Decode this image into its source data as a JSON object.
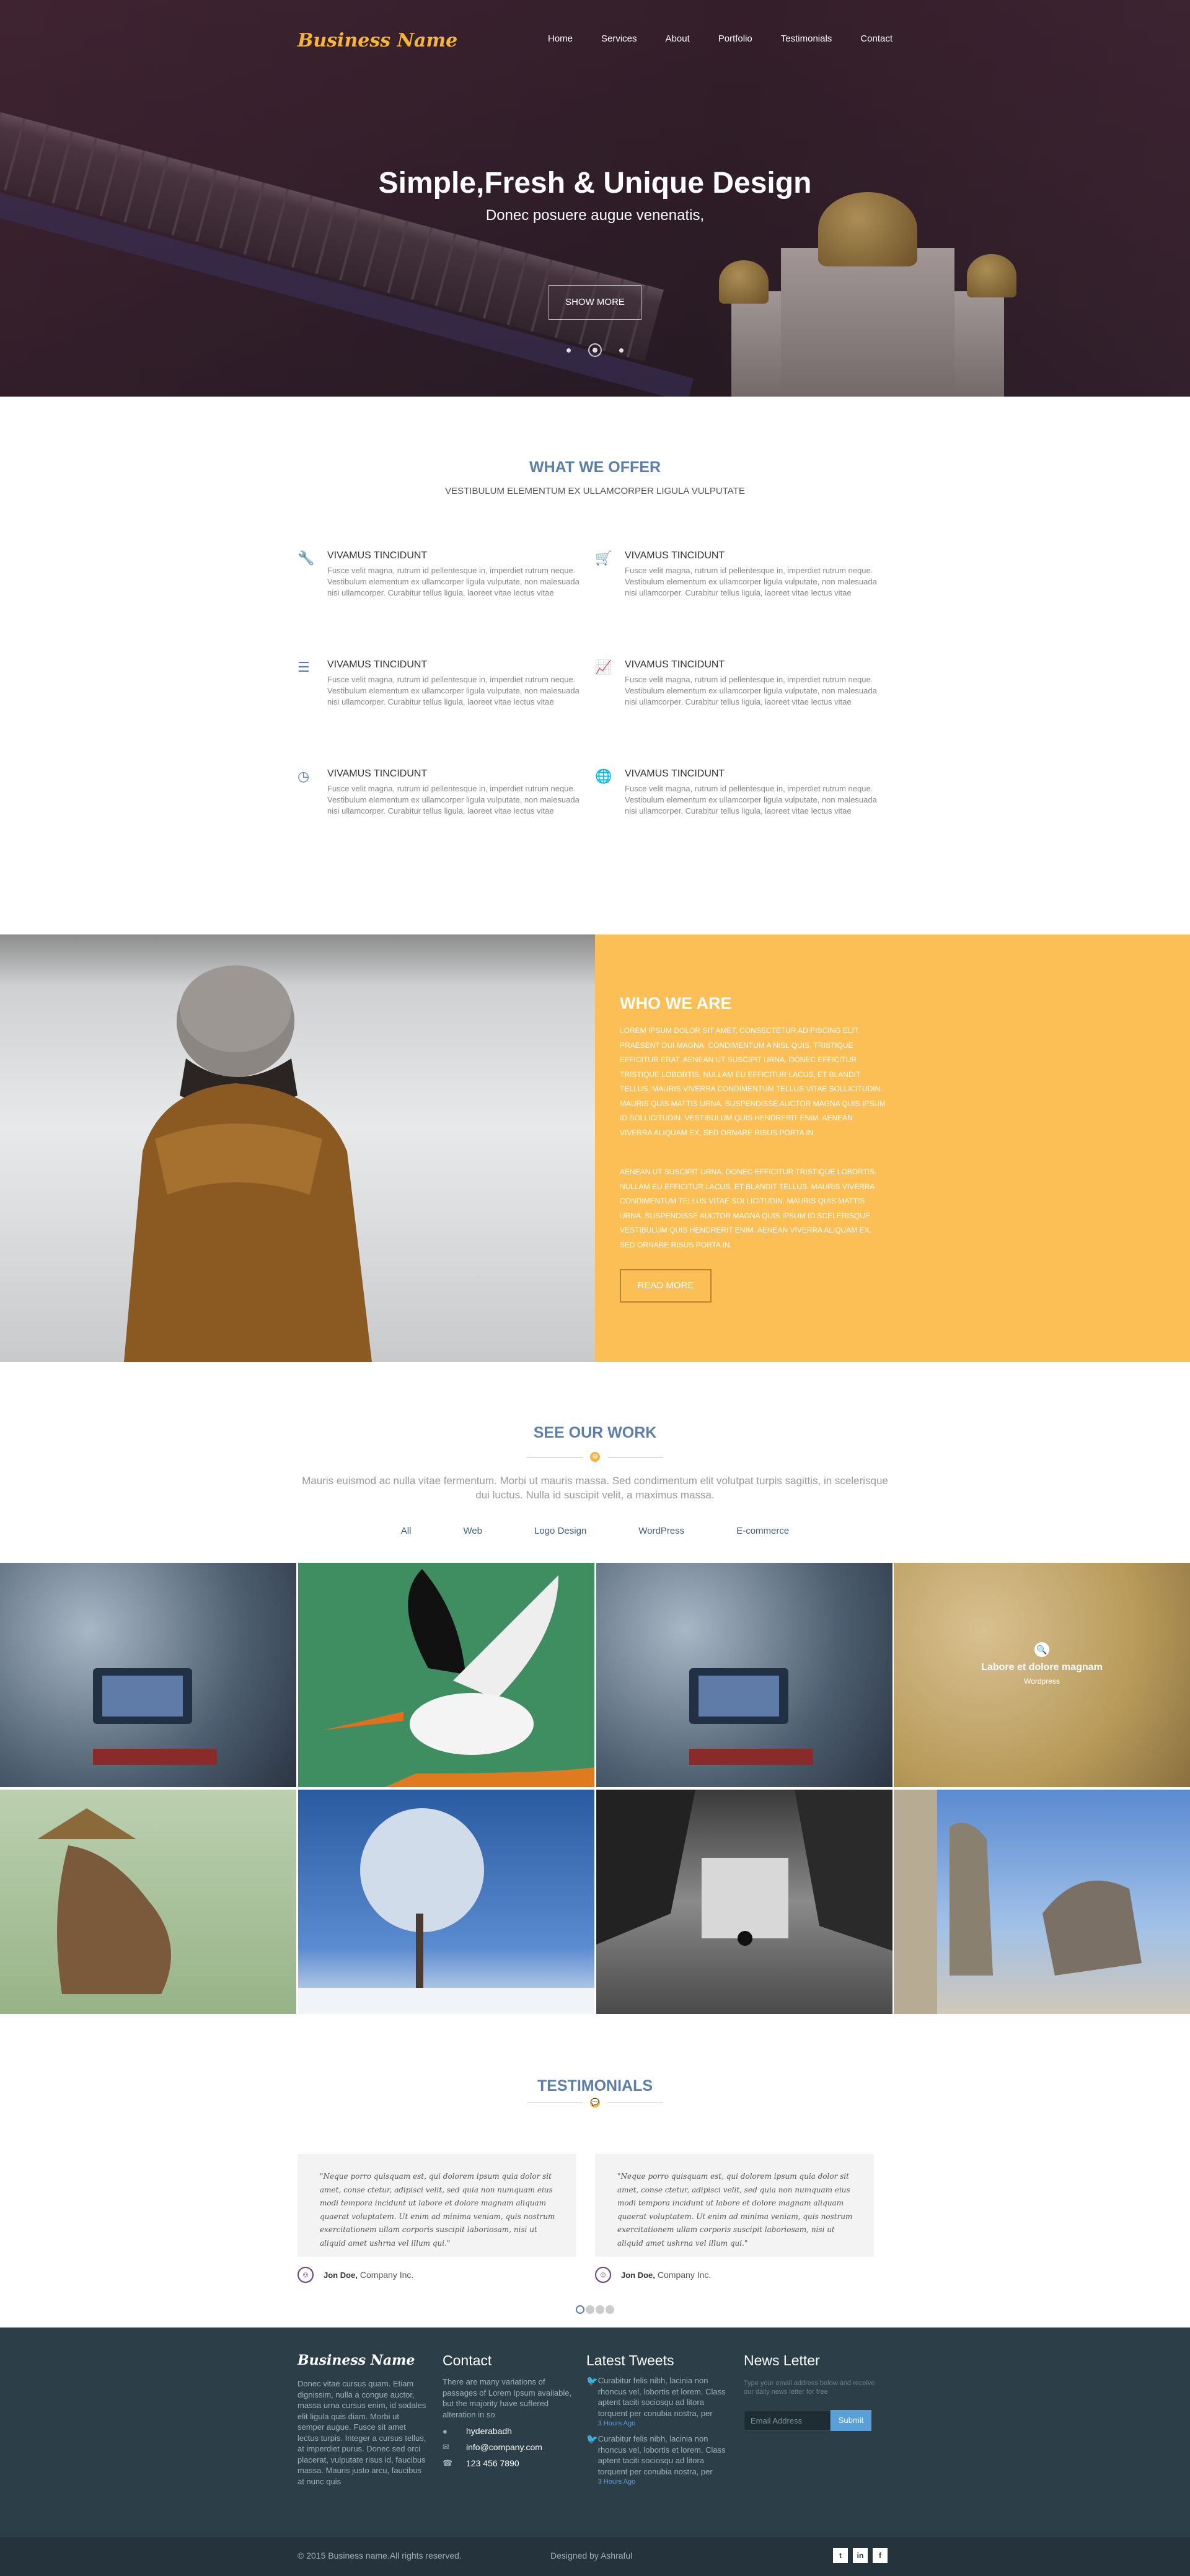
{
  "header": {
    "logo": "Business Name",
    "nav": [
      "Home",
      "Services",
      "About",
      "Portfolio",
      "Testimonials",
      "Contact"
    ]
  },
  "hero": {
    "title": "Simple,Fresh & Unique Design",
    "subtitle": "Donec posuere augue venenatis,",
    "button": "SHOW MORE"
  },
  "offer": {
    "title": "WHAT WE OFFER",
    "subtitle": "VESTIBULUM ELEMENTUM EX ULLAMCORPER LIGULA VULPUTATE",
    "features": [
      {
        "icon": "wrench-icon",
        "title": "VIVAMUS TINCIDUNT",
        "text": "Fusce velit magna, rutrum id pellentesque in, imperdiet rutrum neque. Vestibulum elementum ex ullamcorper ligula vulputate, non malesuada nisi ullamcorper. Curabitur tellus ligula, laoreet vitae lectus vitae"
      },
      {
        "icon": "basket-icon",
        "title": "VIVAMUS TINCIDUNT",
        "text": "Fusce velit magna, rutrum id pellentesque in, imperdiet rutrum neque. Vestibulum elementum ex ullamcorper ligula vulputate, non malesuada nisi ullamcorper. Curabitur tellus ligula, laoreet vitae lectus vitae"
      },
      {
        "icon": "database-icon",
        "title": "VIVAMUS TINCIDUNT",
        "text": "Fusce velit magna, rutrum id pellentesque in, imperdiet rutrum neque. Vestibulum elementum ex ullamcorper ligula vulputate, non malesuada nisi ullamcorper. Curabitur tellus ligula, laoreet vitae lectus vitae"
      },
      {
        "icon": "chart-icon",
        "title": "VIVAMUS TINCIDUNT",
        "text": "Fusce velit magna, rutrum id pellentesque in, imperdiet rutrum neque. Vestibulum elementum ex ullamcorper ligula vulputate, non malesuada nisi ullamcorper. Curabitur tellus ligula, laoreet vitae lectus vitae"
      },
      {
        "icon": "clock-icon",
        "title": "VIVAMUS TINCIDUNT",
        "text": "Fusce velit magna, rutrum id pellentesque in, imperdiet rutrum neque. Vestibulum elementum ex ullamcorper ligula vulputate, non malesuada nisi ullamcorper. Curabitur tellus ligula, laoreet vitae lectus vitae"
      },
      {
        "icon": "globe-icon",
        "title": "VIVAMUS TINCIDUNT",
        "text": "Fusce velit magna, rutrum id pellentesque in, imperdiet rutrum neque. Vestibulum elementum ex ullamcorper ligula vulputate, non malesuada nisi ullamcorper. Curabitur tellus ligula, laoreet vitae lectus vitae"
      }
    ]
  },
  "who": {
    "title": "WHO WE ARE",
    "p1": "Lorem ipsum dolor sit amet, consectetur adipiscing elit. Praesent dui magna, condimentum a nisl quis, tristique efficitur erat. Aenean ut suscipit urna. Donec efficitur tristique lobortis. Nullam eu efficitur lacus, et blandit tellus. Mauris viverra condimentum tellus vitae sollicitudin. Mauris quis mattis urna. Suspendisse auctor magna quis ipsum id sollicitudin. Vestibulum quis hendrerit enim. Aenean viverra aliquam ex, sed ornare risus porta in.",
    "p2": "Aenean ut suscipit urna. Donec efficitur tristique lobortis. Nullam eu efficitur lacus, et blandit tellus. Mauris viverra condimentum tellus vitae sollicitudin. Mauris quis mattis urna. Suspendisse auctor magna quis ipsum id scelerisque. Vestibulum quis hendrerit enim. Aenean viverra aliquam ex, sed ornare risus porta in.",
    "button": "READ MORE"
  },
  "work": {
    "title": "SEE OUR WORK",
    "subtitle": "Mauris euismod ac nulla vitae fermentum. Morbi ut mauris massa. Sed condimentum elit volutpat turpis sagittis, in scelerisque dui luctus. Nulla id suscipit velit, a maximus massa.",
    "filters": [
      "All",
      "Web",
      "Logo Design",
      "WordPress",
      "E-commerce"
    ],
    "hover_title": "Labore et dolore magnam",
    "hover_sub": "Wordpress"
  },
  "testimonials": {
    "title": "TESTIMONIALS",
    "quote": "\"Neque porro quisquam est, qui dolorem ipsum quia dolor sit amet, conse ctetur, adipisci velit, sed quia non numquam eius modi tempora incidunt ut labore et dolore magnam aliquam quaerat voluptatem. Ut enim ad minima veniam, quis nostrum exercitationem ullam corporis suscipit laboriosam, nisi ut aliquid amet ushrna vel illum qui.\"",
    "author": "Jon Doe,",
    "company": "Company Inc."
  },
  "footer": {
    "logo": "Business Name",
    "about": "Donec vitae cursus quam. Etiam dignissim, nulla a congue auctor, massa urna cursus enim, id sodales elit ligula quis diam. Morbi ut semper augue. Fusce sit amet lectus turpis. Integer a cursus tellus, at imperdiet purus. Donec sed orci placerat, vulputate risus id, faucibus massa. Mauris justo arcu, faucibus at nunc quis",
    "contact_title": "Contact",
    "contact_text": "There are many variations of passages of Lorem Ipsum available, but the majority have suffered alteration in so",
    "address": "hyderabadh",
    "email": "info@company.com",
    "phone": "123 456 7890",
    "tweets_title": "Latest Tweets",
    "tweet1": "Curabitur felis nibh, lacinia non rhoncus vel, lobortis et lorem. Class aptent taciti sociosqu ad litora torquent per conubia nostra, per",
    "tweet1_time": "3 Hours Ago",
    "tweet2": "Curabitur felis nibh, lacinia non rhoncus vel, lobortis et lorem. Class aptent taciti sociosqu ad litora torquent per conubia nostra, per",
    "tweet2_time": "3 Hours Ago",
    "news_title": "News Letter",
    "news_text": "Type your email address below and receive our daily news letter for free",
    "email_placeholder": "Email Address",
    "submit": "Submit",
    "copyright": "© 2015 Business name.All rights reserved.",
    "designed": "Designed by Ashraful",
    "social": [
      "twitter-icon",
      "linkedin-icon",
      "facebook-icon"
    ]
  },
  "colors": {
    "accent": "#5b7fad",
    "orange": "#fbbf55",
    "footer": "#2c3e48",
    "brand": "#f6b533"
  }
}
